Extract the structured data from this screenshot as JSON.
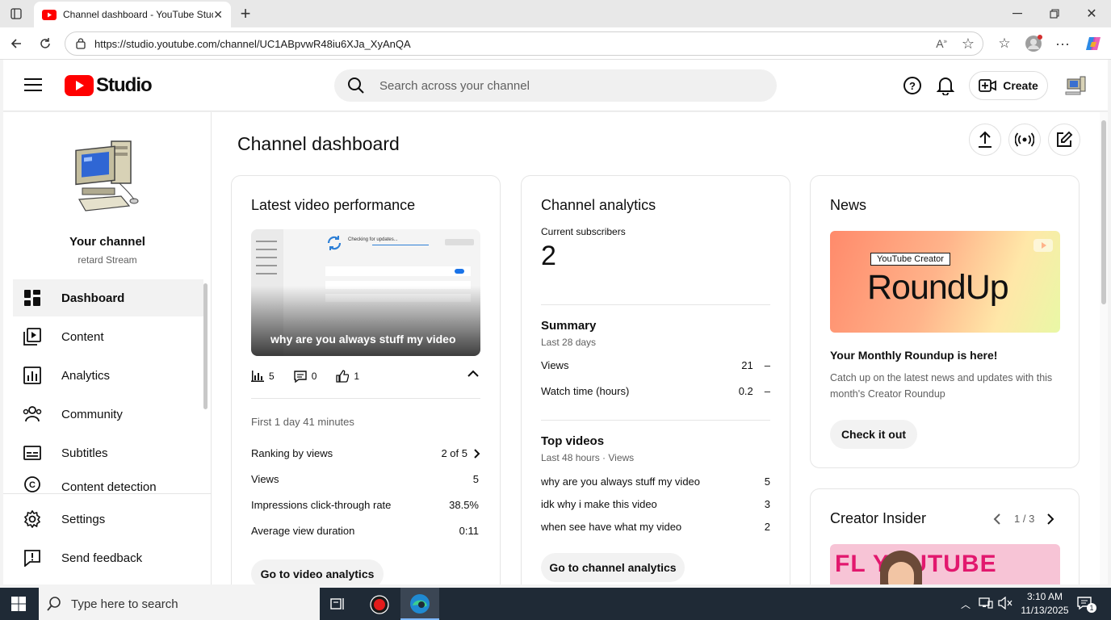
{
  "browser": {
    "tab_title": "Channel dashboard - YouTube Studio",
    "url": "https://studio.youtube.com/channel/UC1ABpvwR48iu6XJa_XyAnQA"
  },
  "header": {
    "logo_text": "Studio",
    "search_placeholder": "Search across your channel",
    "create_label": "Create"
  },
  "sidebar": {
    "channel_title": "Your channel",
    "channel_name": "retard Stream",
    "items": [
      {
        "label": "Dashboard",
        "icon": "dashboard-icon",
        "active": true
      },
      {
        "label": "Content",
        "icon": "content-icon"
      },
      {
        "label": "Analytics",
        "icon": "analytics-icon"
      },
      {
        "label": "Community",
        "icon": "community-icon"
      },
      {
        "label": "Subtitles",
        "icon": "subtitles-icon"
      },
      {
        "label": "Content detection",
        "icon": "content-detection-icon"
      }
    ],
    "bottom": [
      {
        "label": "Settings",
        "icon": "gear-icon"
      },
      {
        "label": "Send feedback",
        "icon": "feedback-icon"
      }
    ]
  },
  "page": {
    "title": "Channel dashboard"
  },
  "latest_video": {
    "heading": "Latest video performance",
    "video_title": "why are you always stuff my video",
    "thumb_text": "Checking for updates...",
    "stats": {
      "views": "5",
      "comments": "0",
      "likes": "1"
    },
    "period": "First 1 day 41 minutes",
    "rows": [
      {
        "label": "Ranking by views",
        "value": "2 of 5"
      },
      {
        "label": "Views",
        "value": "5"
      },
      {
        "label": "Impressions click-through rate",
        "value": "38.5%"
      },
      {
        "label": "Average view duration",
        "value": "0:11"
      }
    ],
    "button": "Go to video analytics"
  },
  "channel_analytics": {
    "heading": "Channel analytics",
    "subs_label": "Current subscribers",
    "subs_value": "2",
    "summary_title": "Summary",
    "summary_period": "Last 28 days",
    "summary_rows": [
      {
        "label": "Views",
        "value": "21",
        "trend": "–"
      },
      {
        "label": "Watch time (hours)",
        "value": "0.2",
        "trend": "–"
      }
    ],
    "top_title": "Top videos",
    "top_period": "Last 48 hours · Views",
    "top_rows": [
      {
        "label": "why are you always stuff my video",
        "value": "5"
      },
      {
        "label": "idk why i make this video",
        "value": "3"
      },
      {
        "label": "when see have what my video",
        "value": "2"
      }
    ],
    "button": "Go to channel analytics"
  },
  "news": {
    "heading": "News",
    "banner_tag": "YouTube Creator",
    "banner_title": "RoundUp",
    "title": "Your Monthly Roundup is here!",
    "body": "Catch up on the latest news and updates with this month's Creator Roundup",
    "button": "Check it out"
  },
  "creator_insider": {
    "heading": "Creator Insider",
    "pager": "1 / 3",
    "thumb_text": "FL YOUTUBE"
  },
  "taskbar": {
    "search_placeholder": "Type here to search",
    "time": "3:10 AM",
    "date": "11/13/2025",
    "notification_count": "1"
  },
  "colors": {
    "youtube_red": "#ff0000",
    "accent_blue": "#065fd4"
  }
}
